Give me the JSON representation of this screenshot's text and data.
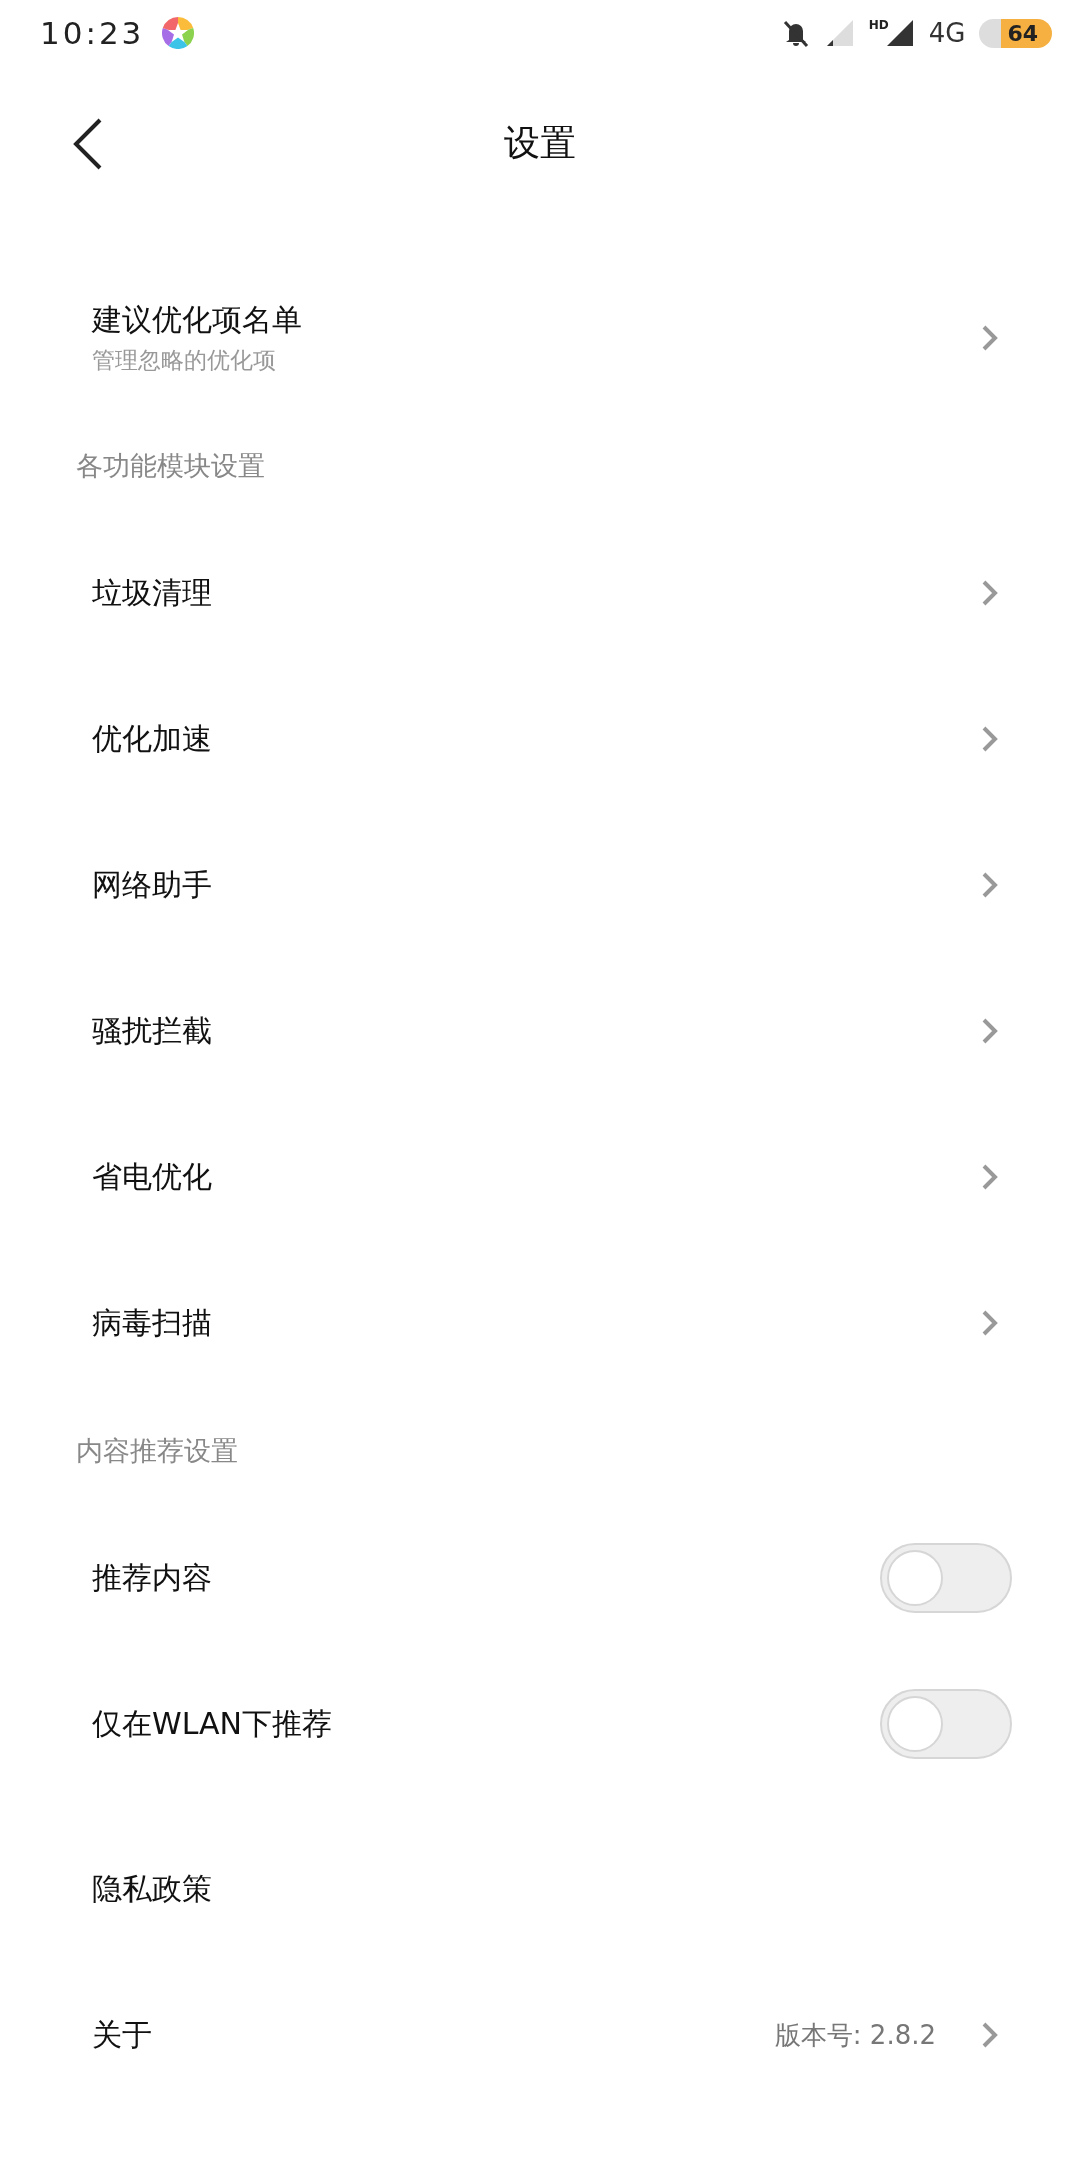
{
  "status_bar": {
    "time": "10:23",
    "hd_label": "HD",
    "network_type": "4G",
    "battery": "64"
  },
  "header": {
    "title": "设置"
  },
  "groups": [
    {
      "items": [
        {
          "kind": "link",
          "label": "建议优化项名单",
          "subtitle": "管理忽略的优化项"
        }
      ]
    },
    {
      "title": "各功能模块设置",
      "items": [
        {
          "kind": "link",
          "label": "垃圾清理"
        },
        {
          "kind": "link",
          "label": "优化加速"
        },
        {
          "kind": "link",
          "label": "网络助手"
        },
        {
          "kind": "link",
          "label": "骚扰拦截"
        },
        {
          "kind": "link",
          "label": "省电优化"
        },
        {
          "kind": "link",
          "label": "病毒扫描"
        }
      ]
    },
    {
      "title": "内容推荐设置",
      "items": [
        {
          "kind": "toggle",
          "label": "推荐内容",
          "on": false
        },
        {
          "kind": "toggle",
          "label": "仅在WLAN下推荐",
          "on": false
        }
      ]
    },
    {
      "items": [
        {
          "kind": "plain",
          "label": "隐私政策"
        },
        {
          "kind": "link",
          "label": "关于",
          "value": "版本号: 2.8.2"
        }
      ]
    }
  ]
}
